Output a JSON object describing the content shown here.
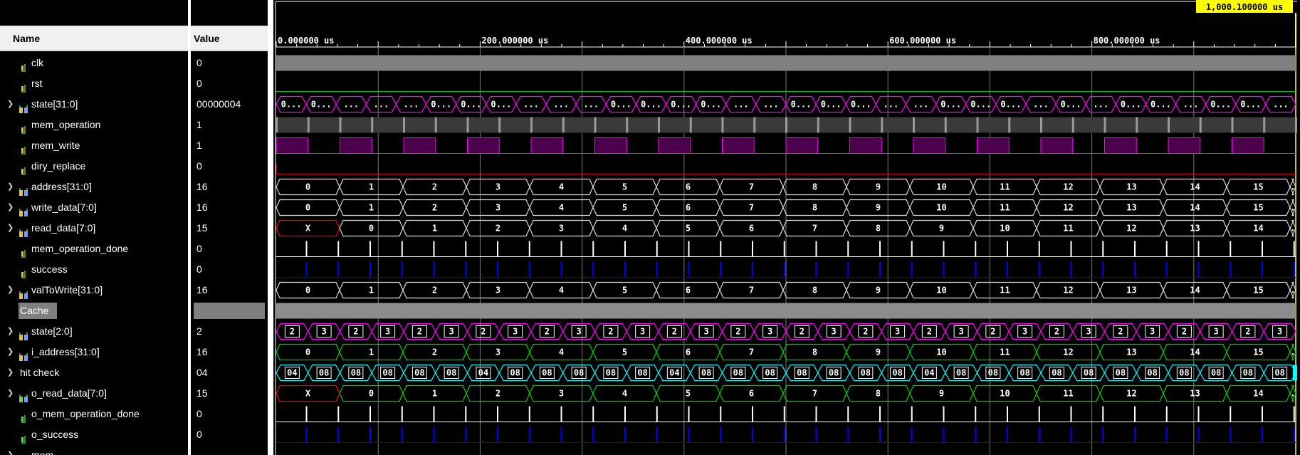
{
  "columns": {
    "name": "Name",
    "value": "Value"
  },
  "cursor": {
    "time_label": "1,000.100000 us"
  },
  "ruler": {
    "labels": [
      "0.000000 us",
      "200.000000 us",
      "400.000000 us",
      "600.000000 us",
      "800.000000 us"
    ],
    "range_us": [
      0,
      1000.1
    ]
  },
  "colors": {
    "clk_fill": "#808080",
    "state_bus": "#ff00ff",
    "bus_default": "#d9d9d9",
    "bus_x": "#ff0000",
    "green_bus": "#00d000",
    "cyan_bus": "#00ffff",
    "blue_pulse": "#0000ff",
    "cursor_label_bg": "#ffff00"
  },
  "signals": [
    {
      "name": "clk",
      "value": "0",
      "icon": "scalar-signal-icon",
      "expandable": false,
      "kind": "clock"
    },
    {
      "name": "rst",
      "value": "0",
      "icon": "scalar-signal-icon",
      "expandable": false,
      "kind": "low"
    },
    {
      "name": "state[31:0]",
      "value": "00000004",
      "icon": "bus-signal-icon",
      "expandable": true,
      "kind": "state-bus",
      "segments": [
        "0...",
        "0...",
        "...",
        "...",
        "...",
        "0...",
        "0...",
        "0...",
        "...",
        "...",
        "...",
        "0...",
        "0...",
        "0...",
        "0...",
        "...",
        "...",
        "0...",
        "0...",
        "0...",
        "...",
        "...",
        "0...",
        "0...",
        "0...",
        "...",
        "0...",
        "...",
        "0...",
        "0...",
        "...",
        "0...",
        "0...",
        "..."
      ]
    },
    {
      "name": "mem_operation",
      "value": "1",
      "icon": "scalar-signal-icon",
      "expandable": false,
      "kind": "memop"
    },
    {
      "name": "mem_write",
      "value": "1",
      "icon": "scalar-signal-icon",
      "expandable": false,
      "kind": "memwrite"
    },
    {
      "name": "diry_replace",
      "value": "0",
      "icon": "scalar-signal-icon",
      "expandable": false,
      "kind": "low-red"
    },
    {
      "name": "address[31:0]",
      "value": "16",
      "icon": "bus-signal-icon",
      "expandable": true,
      "kind": "bus",
      "segments": [
        "0",
        "1",
        "2",
        "3",
        "4",
        "5",
        "6",
        "7",
        "8",
        "9",
        "10",
        "11",
        "12",
        "13",
        "14",
        "15",
        "."
      ]
    },
    {
      "name": "write_data[7:0]",
      "value": "16",
      "icon": "bus-signal-icon",
      "expandable": true,
      "kind": "bus",
      "segments": [
        "0",
        "1",
        "2",
        "3",
        "4",
        "5",
        "6",
        "7",
        "8",
        "9",
        "10",
        "11",
        "12",
        "13",
        "14",
        "15",
        "."
      ]
    },
    {
      "name": "read_data[7:0]",
      "value": "15",
      "icon": "bus-signal-icon",
      "expandable": true,
      "kind": "bus-x",
      "segments": [
        "X",
        "0",
        "1",
        "2",
        "3",
        "4",
        "5",
        "6",
        "7",
        "8",
        "9",
        "10",
        "11",
        "12",
        "13",
        "14",
        "."
      ]
    },
    {
      "name": "mem_operation_done",
      "value": "0",
      "icon": "scalar-signal-icon",
      "expandable": false,
      "kind": "pulse-white"
    },
    {
      "name": "success",
      "value": "0",
      "icon": "scalar-signal-icon",
      "expandable": false,
      "kind": "pulse-blue"
    },
    {
      "name": "valToWrite[31:0]",
      "value": "16",
      "icon": "bus-signal-icon",
      "expandable": true,
      "kind": "bus",
      "segments": [
        "0",
        "1",
        "2",
        "3",
        "4",
        "5",
        "6",
        "7",
        "8",
        "9",
        "10",
        "11",
        "12",
        "13",
        "14",
        "15",
        "."
      ]
    },
    {
      "name": "Cache",
      "value": "",
      "icon": "",
      "expandable": false,
      "kind": "divider"
    },
    {
      "name": "state[2:0]",
      "value": "2",
      "icon": "bus-signal-icon",
      "expandable": true,
      "kind": "state-small",
      "segments": [
        "2",
        "3",
        "2",
        "3",
        "2",
        "3",
        "2",
        "3",
        "2",
        "3",
        "2",
        "3",
        "2",
        "3",
        "2",
        "3",
        "2",
        "3",
        "2",
        "3",
        "2",
        "3",
        "2",
        "3",
        "2",
        "3",
        "2",
        "3",
        "2",
        "3",
        "2",
        "3"
      ]
    },
    {
      "name": "i_address[31:0]",
      "value": "16",
      "icon": "bus-signal-icon",
      "expandable": true,
      "kind": "bus-green",
      "segments": [
        "0",
        "1",
        "2",
        "3",
        "4",
        "5",
        "6",
        "7",
        "8",
        "9",
        "10",
        "11",
        "12",
        "13",
        "14",
        "15",
        "."
      ]
    },
    {
      "name": "hit check",
      "value": "04",
      "icon": "",
      "expandable": true,
      "kind": "hitcheck",
      "segments": [
        "04",
        "08",
        "08",
        "08",
        "08",
        "08",
        "04",
        "08",
        "08",
        "08",
        "08",
        "08",
        "04",
        "08",
        "08",
        "08",
        "08",
        "08",
        "08",
        "08",
        "04",
        "08",
        "08",
        "08",
        "08",
        "08",
        "08",
        "08",
        "08",
        "08",
        "08",
        "08"
      ]
    },
    {
      "name": "o_read_data[7:0]",
      "value": "15",
      "icon": "bus-signal-icon-green",
      "expandable": true,
      "kind": "bus-green-x",
      "segments": [
        "X",
        "0",
        "1",
        "2",
        "3",
        "4",
        "5",
        "6",
        "7",
        "8",
        "9",
        "10",
        "11",
        "12",
        "13",
        "14",
        "."
      ]
    },
    {
      "name": "o_mem_operation_done",
      "value": "0",
      "icon": "scalar-signal-icon-green",
      "expandable": false,
      "kind": "pulse-white"
    },
    {
      "name": "o_success",
      "value": "0",
      "icon": "scalar-signal-icon-green",
      "expandable": false,
      "kind": "pulse-blue"
    },
    {
      "name": "mem",
      "value": "",
      "icon": "bus-signal-icon",
      "expandable": true,
      "kind": "none"
    }
  ]
}
